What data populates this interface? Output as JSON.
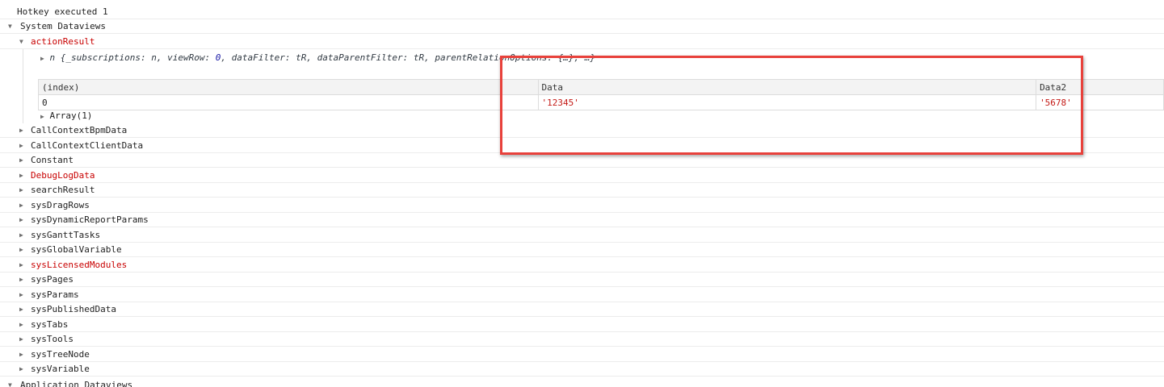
{
  "top_line": "Hotkey executed 1",
  "system_group": "System Dataviews",
  "action_result": {
    "name": "actionResult",
    "preview": {
      "prefix": "n {",
      "subscriptions_key": "_subscriptions: ",
      "subscriptions_val": "n",
      "viewrow_key": "viewRow: ",
      "viewrow_val": "0",
      "datafilter_key": "dataFilter: ",
      "datafilter_val": "tR",
      "dataparentfilter_key": "dataParentFilter: ",
      "dataparentfilter_val": "tR",
      "parentrel_key": "parentRelationOptions: ",
      "parentrel_val": "{…}, …}"
    },
    "table": {
      "headers": [
        "(index)",
        "Data",
        "Data2"
      ],
      "rows": [
        [
          "0",
          "'12345'",
          "'5678'"
        ]
      ]
    },
    "array_label": "Array(1)"
  },
  "dataviews": [
    {
      "name": "CallContextBpmData",
      "red": false
    },
    {
      "name": "CallContextClientData",
      "red": false
    },
    {
      "name": "Constant",
      "red": false
    },
    {
      "name": "DebugLogData",
      "red": true
    },
    {
      "name": "searchResult",
      "red": false
    },
    {
      "name": "sysDragRows",
      "red": false
    },
    {
      "name": "sysDynamicReportParams",
      "red": false
    },
    {
      "name": "sysGanttTasks",
      "red": false
    },
    {
      "name": "sysGlobalVariable",
      "red": false
    },
    {
      "name": "sysLicensedModules",
      "red": true
    },
    {
      "name": "sysPages",
      "red": false
    },
    {
      "name": "sysParams",
      "red": false
    },
    {
      "name": "sysPublishedData",
      "red": false
    },
    {
      "name": "sysTabs",
      "red": false
    },
    {
      "name": "sysTools",
      "red": false
    },
    {
      "name": "sysTreeNode",
      "red": false
    },
    {
      "name": "sysVariable",
      "red": false
    }
  ],
  "app_group": "Application Dataviews",
  "colors": {
    "highlight": "#e8413b",
    "red_text": "#c80000"
  }
}
